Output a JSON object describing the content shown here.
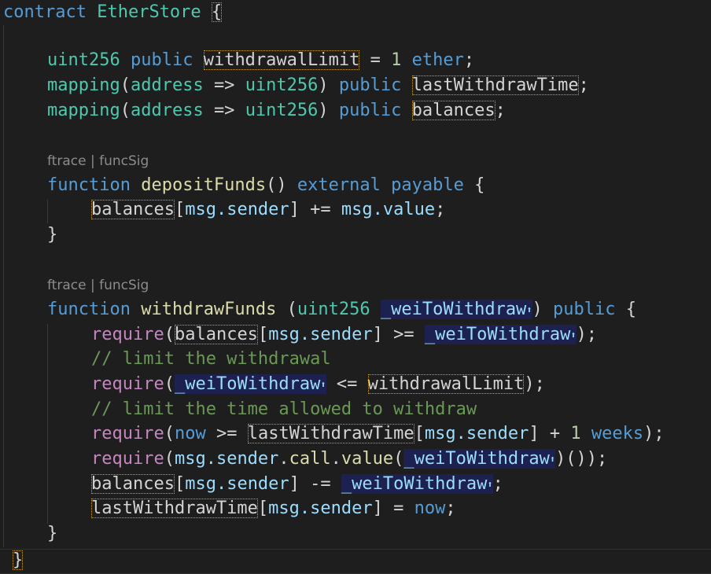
{
  "editor": {
    "code_lens_1": "ftrace | funcSig",
    "code_lens_2": "ftrace | funcSig",
    "lines": {
      "l1": {
        "kw": "contract",
        "name": "EtherStore",
        "brace": "{"
      },
      "l2": {
        "type": "uint256",
        "mod": "public",
        "name": "withdrawalLimit",
        "eq": "=",
        "num": "1",
        "unit": "ether",
        "semi": ";"
      },
      "l3": {
        "map": "mapping",
        "lp": "(",
        "addr": "address",
        "arrow": "=>",
        "type": "uint256",
        "rp": ")",
        "mod": "public",
        "name": "lastWithdrawTime",
        "semi": ";"
      },
      "l4": {
        "map": "mapping",
        "lp": "(",
        "addr": "address",
        "arrow": "=>",
        "type": "uint256",
        "rp": ")",
        "mod": "public",
        "name": "balances",
        "semi": ";"
      },
      "l5": {
        "kw": "function",
        "name": "depositFunds",
        "parens": "()",
        "ext": "external",
        "pay": "payable",
        "brace": "{"
      },
      "l6": {
        "var": "balances",
        "lb": "[",
        "msg": "msg.sender",
        "rb": "]",
        "op": "+=",
        "val": "msg.value",
        "semi": ";"
      },
      "l7": {
        "brace": "}"
      },
      "l8": {
        "kw": "function",
        "name": "withdrawFunds",
        "lp": " (",
        "type": "uint256",
        "param": "_weiToWithdraw",
        "up": "⬆",
        "rp": ")",
        "mod": "public",
        "brace": "{"
      },
      "l9": {
        "req": "require",
        "lp": "(",
        "var": "balances",
        "lb": "[",
        "msg": "msg.sender",
        "rb": "]",
        "op": ">=",
        "param": "_weiToWithdraw",
        "up": "⬆",
        "end": ");"
      },
      "l10": {
        "comment": "// limit the withdrawal"
      },
      "l11": {
        "req": "require",
        "lp": "(",
        "param": "_weiToWithdraw",
        "up": "⬆",
        "op": "<=",
        "var": "withdrawalLimit",
        "end": ");"
      },
      "l12": {
        "comment": "// limit the time allowed to withdraw"
      },
      "l13": {
        "req": "require",
        "lp": "(",
        "now": "now",
        "op": ">=",
        "var": "lastWithdrawTime",
        "lb": "[",
        "msg": "msg.sender",
        "rb": "]",
        "plus": "+",
        "num": "1",
        "unit": "weeks",
        "end": ");"
      },
      "l14": {
        "req": "require",
        "lp": "(",
        "msg": "msg.sender",
        "dot1": ".",
        "call": "call",
        "dot2": ".",
        "value": "value",
        "lp2": "(",
        "param": "_weiToWithdraw",
        "up": "⬆",
        "end": ")());"
      },
      "l15": {
        "var": "balances",
        "lb": "[",
        "msg": "msg.sender",
        "rb": "]",
        "op": "-=",
        "param": "_weiToWithdraw",
        "up": "⬆",
        "semi": ";"
      },
      "l16": {
        "var": "lastWithdrawTime",
        "lb": "[",
        "msg": "msg.sender",
        "rb": "]",
        "op": "=",
        "now": "now",
        "semi": ";"
      },
      "l17": {
        "brace": "}"
      },
      "l18": {
        "brace": "}"
      }
    }
  }
}
